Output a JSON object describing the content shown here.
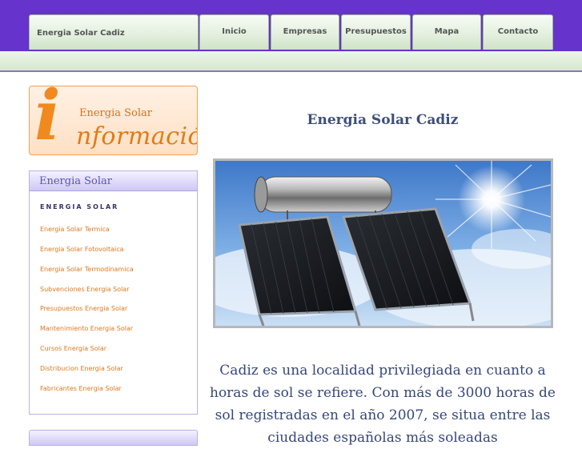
{
  "nav": {
    "site_tab": "Energia Solar Cadiz",
    "items": [
      "Inicio",
      "Empresas",
      "Presupuestos",
      "Mapa",
      "Contacto"
    ]
  },
  "info_banner": {
    "letter": "i",
    "small_text": "Energia Solar",
    "big_text": "nformación"
  },
  "sidebar": {
    "heading": "Energia Solar",
    "subheading": "ENERGIA SOLAR",
    "links": [
      "Energia Solar Termica",
      "Energia Solar Fotovoltaica",
      "Energia Solar Termodinamica",
      "Subvenciones Energia Solar",
      "Presupuestos Energia Solar",
      "Mantenimiento Energia Solar",
      "Cursos Energia Solar",
      "Distribucion Energia Solar",
      "Fabricantes Energia Solar"
    ]
  },
  "main": {
    "title": "Energia Solar Cadiz",
    "hero_image": "solar-thermal-panels-under-sun-photo",
    "paragraph": "Cadiz es una localidad privilegiada en cuanto a horas de sol se refiere. Con más de 3000 horas de sol registradas en el año 2007, se situa entre las ciudades españolas más soleadas"
  },
  "colors": {
    "header_purple": "#6633cc",
    "tab_green": "#e4f0df",
    "accent_orange": "#e07c16",
    "text_blue": "#36477a",
    "sidebar_lavender": "#cfc8f4"
  }
}
